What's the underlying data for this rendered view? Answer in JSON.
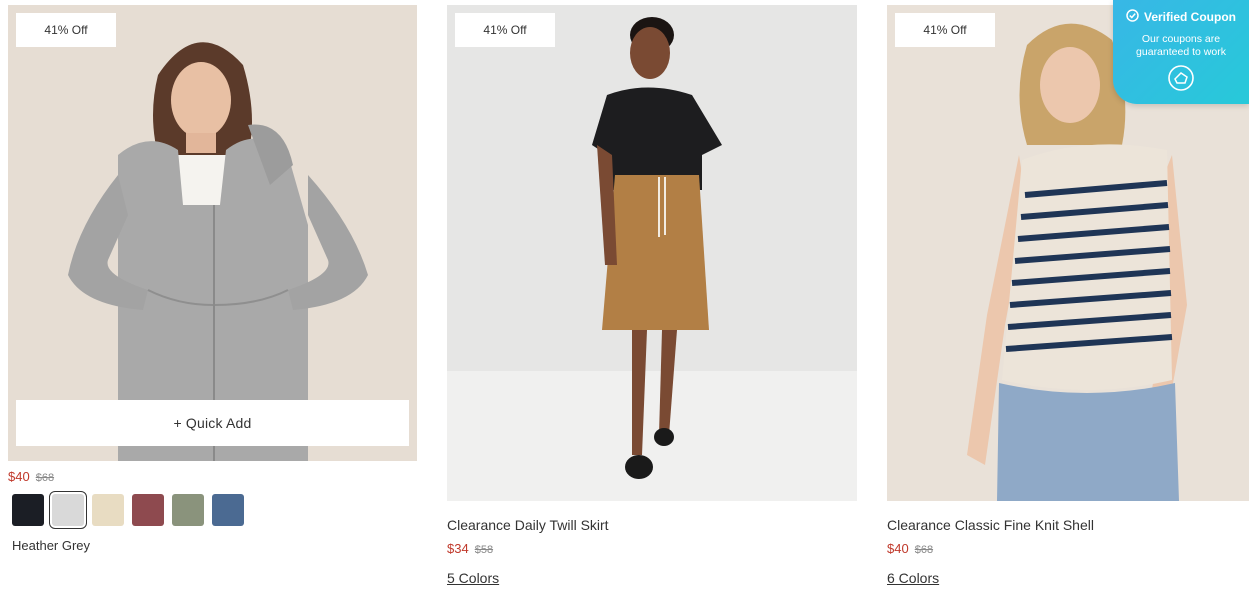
{
  "products": [
    {
      "discount_badge": "41% Off",
      "quick_add": "+ Quick Add",
      "sale_price": "$40",
      "original_price": "$68",
      "swatches": [
        {
          "name": "black",
          "color": "#1b1e25"
        },
        {
          "name": "heather-grey",
          "color": "#d9d9d9"
        },
        {
          "name": "oat",
          "color": "#e8dcc2"
        },
        {
          "name": "berry",
          "color": "#8e4a4f"
        },
        {
          "name": "sage",
          "color": "#8a937c"
        },
        {
          "name": "blue",
          "color": "#4b6a92"
        }
      ],
      "selected_color": "Heather Grey"
    },
    {
      "discount_badge": "41% Off",
      "title": "Clearance Daily Twill Skirt",
      "sale_price": "$34",
      "original_price": "$58",
      "colors_link": "5 Colors"
    },
    {
      "discount_badge": "41% Off",
      "title": "Clearance Classic Fine Knit Shell",
      "sale_price": "$40",
      "original_price": "$68",
      "colors_link": "6 Colors"
    }
  ],
  "coupon": {
    "title": "Verified Coupon",
    "subtitle": "Our coupons are guaranteed to work",
    "icon": "coupon-brand-icon"
  }
}
